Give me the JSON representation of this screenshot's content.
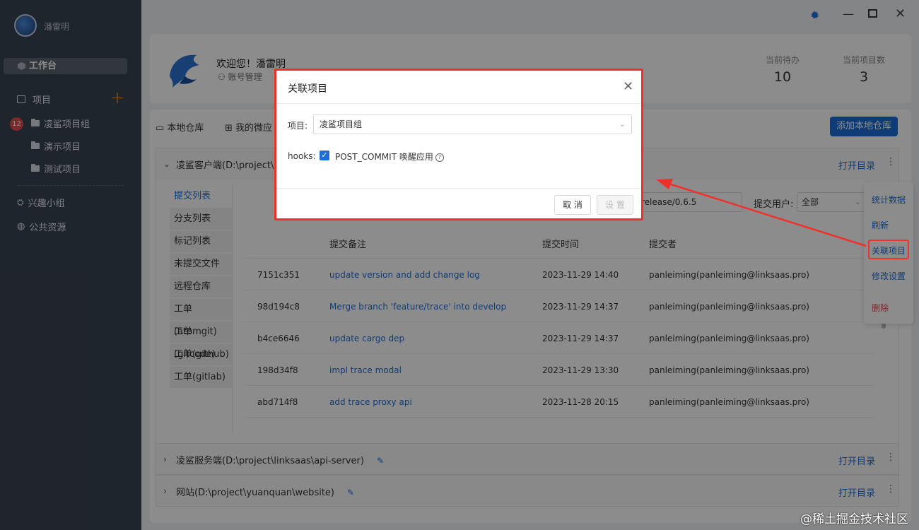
{
  "sidebar": {
    "user_name": "潘雷明",
    "workbench": "工作台",
    "projects_label": "项目",
    "badge_count": "12",
    "project_items": [
      "凌鲨项目组",
      "演示项目",
      "测试项目"
    ],
    "group_label": "兴趣小组",
    "public_label": "公共资源"
  },
  "header": {
    "welcome": "欢迎您！潘雷明",
    "account": "账号管理",
    "stats": [
      {
        "label": "当前待办",
        "value": "10"
      },
      {
        "label": "当前项目数",
        "value": "3"
      }
    ]
  },
  "tabs": {
    "local_repo": "本地仓库",
    "my_micro": "我的微应",
    "add_local_repo": "添加本地仓库"
  },
  "repos": [
    {
      "name": "凌鲨客户端(D:\\project\\link",
      "open_dir": "打开目录"
    },
    {
      "name": "凌鲨服务端(D:\\project\\linksaas\\api-server)",
      "open_dir": "打开目录"
    },
    {
      "name": "网站(D:\\project\\yuanquan\\website)",
      "open_dir": "打开目录"
    }
  ],
  "left_nav": [
    "提交列表",
    "分支列表",
    "标记列表",
    "未提交文件",
    "远程仓库",
    "工单(atomgit)",
    "工单(gitcode)",
    "工单(github)",
    "工单(gitlab)"
  ],
  "filters": {
    "branch_value": "release/0.6.5",
    "user_label": "提交用户:",
    "user_value": "全部"
  },
  "table": {
    "headers": [
      "提交备注",
      "提交时间",
      "提交者"
    ],
    "rows": [
      {
        "hash": "7151c351",
        "msg": "update version and add change log",
        "time": "2023-11-29 14:40",
        "author": "panleiming(panleiming@linksaas.pro)"
      },
      {
        "hash": "98d194c8",
        "msg": "Merge branch 'feature/trace' into develop",
        "time": "2023-11-29 14:37",
        "author": "panleiming(panleiming@linksaas.pro)"
      },
      {
        "hash": "b4ce6646",
        "msg": "update cargo dep",
        "time": "2023-11-29 14:37",
        "author": "panleiming(panleiming@linksaas.pro)"
      },
      {
        "hash": "198d34f8",
        "msg": "impl trace modal",
        "time": "2023-11-29 13:30",
        "author": "panleiming(panleiming@linksaas.pro)"
      },
      {
        "hash": "abd714f8",
        "msg": "add trace proxy api",
        "time": "2023-11-28 20:15",
        "author": "panleiming(panleiming@linksaas.pro)"
      }
    ]
  },
  "context_menu": [
    "统计数据",
    "刷新",
    "关联项目",
    "修改设置",
    "删除"
  ],
  "modal": {
    "title": "关联项目",
    "project_label": "项目:",
    "project_value": "凌鲨项目组",
    "hooks_label": "hooks:",
    "hooks_option": "POST_COMMIT 唤醒应用",
    "cancel": "取 消",
    "confirm": "设 置"
  },
  "watermark": "@稀土掘金技术社区",
  "colors": {
    "accent": "#1d6ed8",
    "sidebar": "#3a4452",
    "highlight": "#f0302a"
  }
}
